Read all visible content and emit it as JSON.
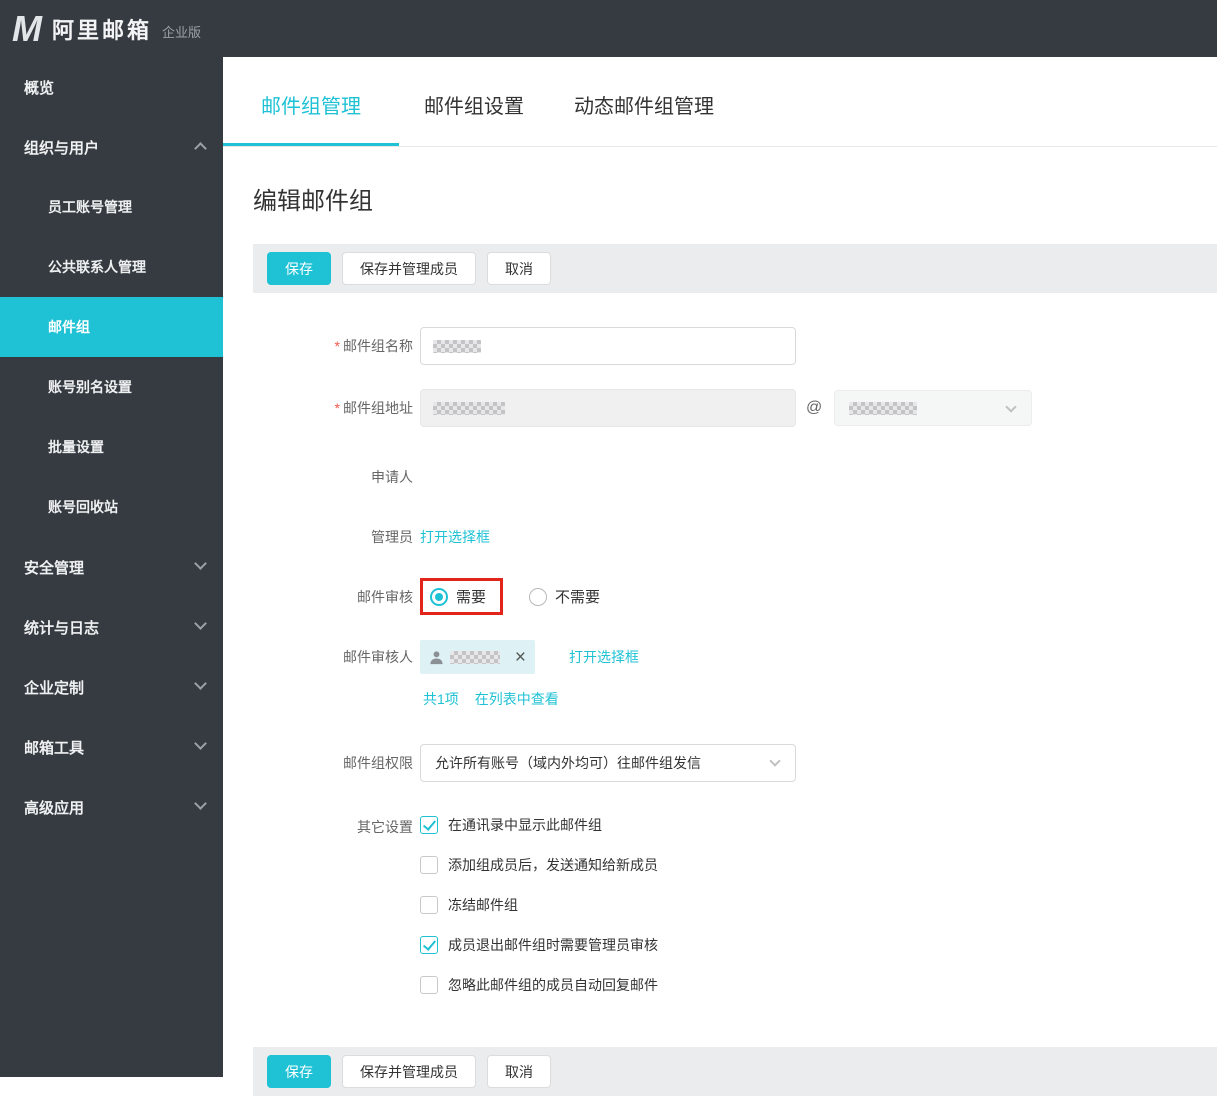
{
  "header": {
    "logo_mark": "M",
    "product_name": "阿里邮箱",
    "edition": "企业版"
  },
  "sidebar": {
    "items": [
      {
        "label": "概览",
        "level": 1
      },
      {
        "label": "组织与用户",
        "level": 1,
        "state": "expanded"
      },
      {
        "label": "员工账号管理",
        "level": 2
      },
      {
        "label": "公共联系人管理",
        "level": 2
      },
      {
        "label": "邮件组",
        "level": 2,
        "active": true
      },
      {
        "label": "账号别名设置",
        "level": 2
      },
      {
        "label": "批量设置",
        "level": 2
      },
      {
        "label": "账号回收站",
        "level": 2
      },
      {
        "label": "安全管理",
        "level": 1,
        "state": "collapsed"
      },
      {
        "label": "统计与日志",
        "level": 1,
        "state": "collapsed"
      },
      {
        "label": "企业定制",
        "level": 1,
        "state": "collapsed"
      },
      {
        "label": "邮箱工具",
        "level": 1,
        "state": "collapsed"
      },
      {
        "label": "高级应用",
        "level": 1,
        "state": "collapsed"
      }
    ]
  },
  "tabs": {
    "items": [
      {
        "label": "邮件组管理",
        "active": true
      },
      {
        "label": "邮件组设置",
        "active": false
      },
      {
        "label": "动态邮件组管理",
        "active": false
      }
    ]
  },
  "page": {
    "title": "编辑邮件组"
  },
  "toolbar": {
    "save": "保存",
    "save_and_manage": "保存并管理成员",
    "cancel": "取消"
  },
  "form": {
    "required_mark": "*",
    "name": {
      "label": "邮件组名称",
      "value_redacted": true
    },
    "address": {
      "label": "邮件组地址",
      "value_redacted": true,
      "at_sign": "@",
      "domain_redacted": true
    },
    "applicant": {
      "label": "申请人"
    },
    "admin": {
      "label": "管理员",
      "open_link": "打开选择框"
    },
    "review": {
      "label": "邮件审核",
      "options": [
        {
          "label": "需要",
          "selected": true,
          "annotated": true
        },
        {
          "label": "不需要",
          "selected": false
        }
      ]
    },
    "reviewer": {
      "label": "邮件审核人",
      "chip_redacted": true,
      "remove_icon": "×",
      "open_link": "打开选择框",
      "count_text": "共1项",
      "view_link": "在列表中查看"
    },
    "permission": {
      "label": "邮件组权限",
      "value": "允许所有账号（域内外均可）往邮件组发信"
    },
    "other": {
      "label": "其它设置",
      "options": [
        {
          "label": "在通讯录中显示此邮件组",
          "checked": true
        },
        {
          "label": "添加组成员后，发送通知给新成员",
          "checked": false
        },
        {
          "label": "冻结邮件组",
          "checked": false
        },
        {
          "label": "成员退出邮件组时需要管理员审核",
          "checked": true
        },
        {
          "label": "忽略此邮件组的成员自动回复邮件",
          "checked": false
        }
      ]
    }
  },
  "colors": {
    "accent_cyan": "#1fc2d5",
    "sidebar_bg": "#353b41",
    "annotation_red": "#e1251b",
    "toolbar_strip": "#ebeced"
  }
}
